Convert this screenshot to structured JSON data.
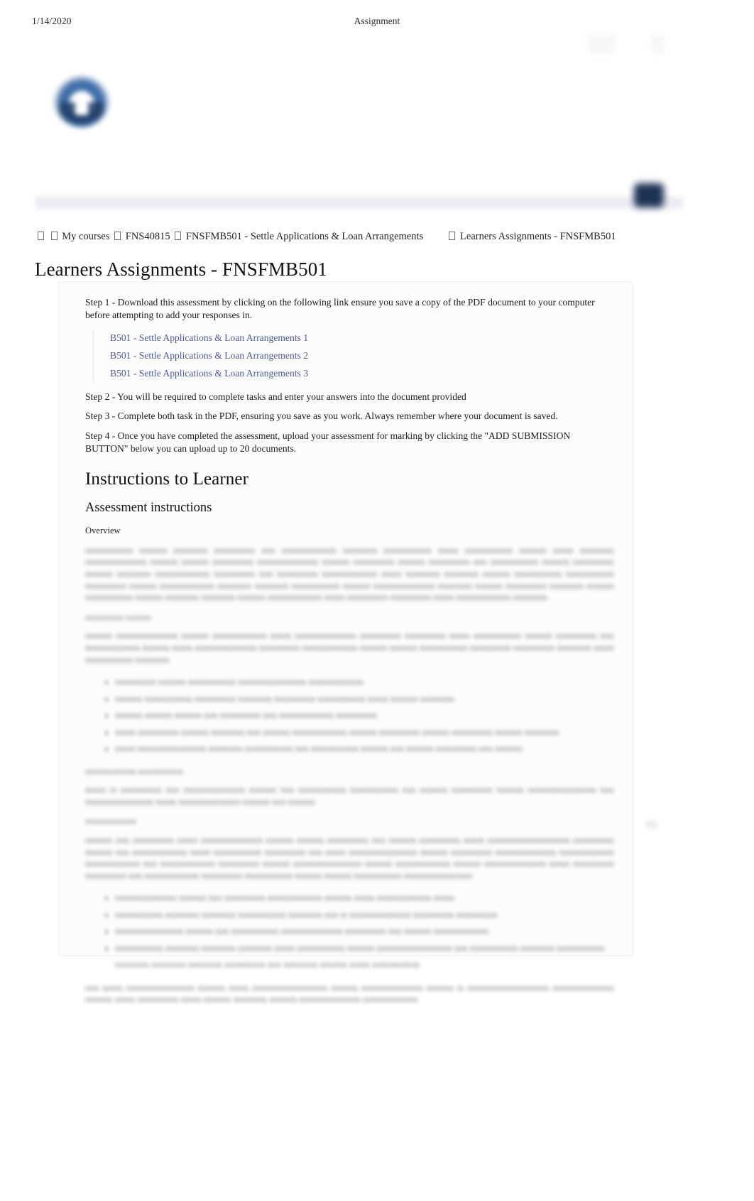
{
  "print_header": {
    "date": "1/14/2020",
    "title": "Assignment"
  },
  "site": {
    "logo_name": "organisation-logo"
  },
  "breadcrumb": {
    "home_icon": "home-icon",
    "separator_icon": "chevron-right-icon",
    "items": [
      {
        "label": "My courses"
      },
      {
        "label": "FNS40815"
      },
      {
        "label": "FNSFMB501 - Settle Applications & Loan Arrangements"
      },
      {
        "label": "Learners Assignments - FNSFMB501"
      }
    ]
  },
  "page": {
    "title": "Learners Assignments - FNSFMB501"
  },
  "assignment": {
    "step1": "Step 1 - Download this assessment by clicking on the following link ensure you save a copy of the PDF document to your computer before attempting to add your responses in.",
    "links": [
      "B501 - Settle Applications & Loan Arrangements 1",
      "B501 - Settle Applications & Loan Arrangements 2",
      "B501 - Settle Applications & Loan Arrangements 3"
    ],
    "step2": "Step 2 - You will be required to complete tasks and enter your answers into the document provided",
    "step3": "Step 3 - Complete both task in the PDF, ensuring you save as you work. Always remember where your document is saved.",
    "step4": "Step 4 - Once you have completed the assessment, upload your assessment for marking by clicking the \"ADD SUBMISSION BUTTON\" below you can upload up to 20 documents.",
    "instructions_heading": "Instructions to Learner",
    "assessment_heading": "Assessment instructions",
    "overview_label": "Overview"
  },
  "redacted_body": {
    "note": "blurred-unreadable-content",
    "paragraph_1": "mmmmmmm mmmm mmmmm mmmmmm mm mmmmmmmm mmmmm mmmmmmm mmm mmmmmmm mmmm mmm mmmmm mmmmmmmmm mmmm mmmm mmmmmm mmmmmmmmm mmmm mmmmmm mmmm mmmmmm mm mmmmmmm mmmm mmmmmm mmmm mmmmm mmmmmmmm mmmmmm mm mmmmmm mmmmmmmm mmm mmmmm mmmmm mmmm mmmmmmm mmmmmmm mmmmmm mmmm mmmmmmmm mmmmm mmmmm mmmmmmm mmmm mmmmmmmmm mmmmm mmmm mmmmmm mmmmm mmmm mmmmmmm mmmm mmmmm mmmmm mmmm mmmmmmmm mmm mmmmmm mmmmmm mmm mmmmmmmm mmmmm",
    "label_1": "mmmmmm mmmm",
    "paragraph_2": "mmmm mmmmmmmmm mmmm mmmmmmmm mmm mmmmmmmmm mmmmmm mmmmmm mmm mmmmmmm mmmm mmmmmm mm mmmmmmmm mmmm mmm mmmmmmmmm mmmmmm mmmmmmmm mmmm mmmm mmmmmmm mmmmmm mmmmmm mmmmm mmm mmmmmmm mmmmm",
    "bullets_1": [
      "mmmmmm mmmm mmmmmmm mmmmmmmmmm mmmmmmmm",
      "mmmm mmmmmmm mmmmmm mmmmm mmmmmm mmmmmmm mmm mmmm mmmmm",
      "mmmm mmmm mmmm mm mmmmmm mm mmmmmmmm mmmmmm",
      "mmm mmmmmm mmmm mmmmm mm mmmm mmmmmmmm mmmm mmmmmm mmmm mmmmmm mmmm mmmmm",
      "mmm mmmmmmmmmm mmmmm mmmmmmm mm mmmmmmm mmmm mm mmmm mmmmmm mm mmmm"
    ],
    "label_2": "mmmmmmmm mmmmmmm",
    "paragraph_3": "mmm m mmmmmm mm mmmmmmmmm mmmm mm mmmmmmm mmmmmmm mm mmmm mmmmmm mmmm mmmmmmmmmm mm mmmmmmmmmm mmm mmmmmmmmm mmmm mm mmmm",
    "label_3": "mmmmmmmm",
    "paragraph_4": "mmmm mm mmmmmm mmm mmmmmmmmm mmmm mmmm mmmmmm mm mmmm mmmmmm mmm mmmmmmmmmmmm mmmmmm mmmm mm mmmmmmmm mmm mmmmmmm mmmmmm mm mmm mmmmmmmmmm mmmm mmmmmm mmmmmmmmm mmmmmmmm mmmmmmmm mm mmmmmmmm mmmmmm mmmm mmmmmmmmmm mmmm mmmmmmmm mmmm mmmmmmmmm mmm mmmmmm mmmmmm mm mmmmmmmm mmmmmm mmmmmmm mmmm mmmm mmmmmmm mmmmmmmmmm",
    "bullets_2": [
      "mmmmmmmmm mmmm mm mmmmmm mmmmmmmm mmmm mmm mmmmmmmm mmm",
      "mmmmmmm mmmmm mmmmm mmmmmmm mmmmm mm m mmmmmmmmm mmmmmm mmmmmm",
      "mmmmmmmmmm mmmm mm mmmmmmm mmmmmmmmm mmmmmm mm mmmm mmmmmmmm",
      "mmmmmmm mmmmm mmmmm mmmmm mmm mmmmmmm mmmm mmmmmmmmmmm mm mmmmmmm mmmmm mmmmmmm mmmmm mmmmm mmmmm mmmmmm mm mmmmm mmmm mmm mmmmmmm"
    ],
    "paragraph_5": "mm mmm mmmmmmmmmm mmmm mmm mmmmmmmmmmm mmmm mmmmmmmmm mmmm m mmmmmmmmmmmm mmmmmmmmm mmmm mmm mmmmmm mmm mmmm mmmmm mmmm mmmmmmmmm mmmmmmmm"
  }
}
